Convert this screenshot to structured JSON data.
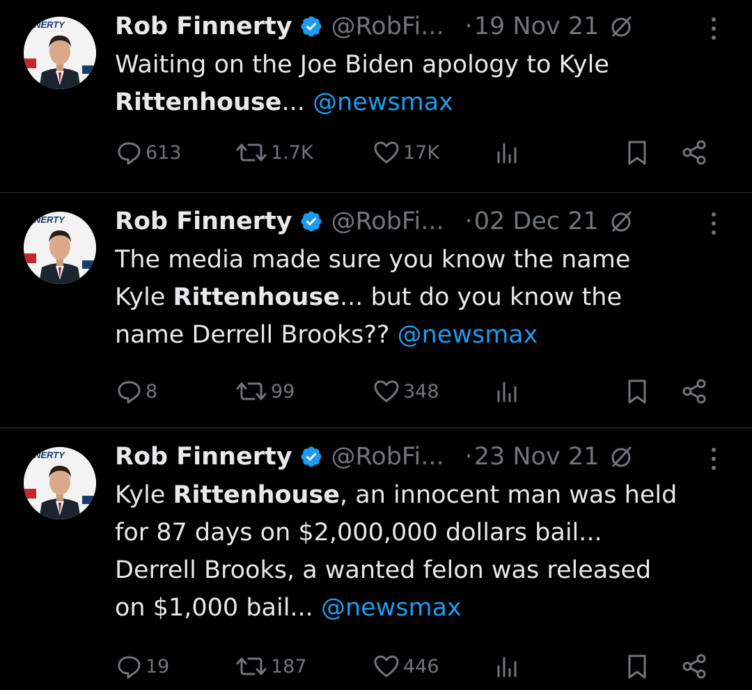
{
  "tweets": [
    {
      "name": "Rob Finnerty",
      "handle": "@RobFi...",
      "dot": "·",
      "date": "19 Nov 21",
      "avatar_text": "FINNERTY",
      "lines": [
        [
          {
            "t": "Waiting on the Joe Biden apology to Kyle"
          }
        ],
        [
          {
            "t": "Rittenhouse",
            "b": true
          },
          {
            "t": "... "
          },
          {
            "t": "@newsmax",
            "m": true
          }
        ]
      ],
      "replies": "613",
      "reposts": "1.7K",
      "likes": "17K"
    },
    {
      "name": "Rob Finnerty",
      "handle": "@RobFi...",
      "dot": "·",
      "date": "02 Dec 21",
      "avatar_text": "FINNERTY",
      "lines": [
        [
          {
            "t": "The media made sure you know the name"
          }
        ],
        [
          {
            "t": "Kyle "
          },
          {
            "t": "Rittenhouse",
            "b": true
          },
          {
            "t": "... but do you know the"
          }
        ],
        [
          {
            "t": "name Derrell Brooks??  "
          },
          {
            "t": "@newsmax",
            "m": true
          }
        ]
      ],
      "replies": "8",
      "reposts": "99",
      "likes": "348"
    },
    {
      "name": "Rob Finnerty",
      "handle": "@RobFi...",
      "dot": "·",
      "date": "23 Nov 21",
      "avatar_text": "FINNERTY",
      "lines": [
        [
          {
            "t": "Kyle "
          },
          {
            "t": "Rittenhouse",
            "b": true
          },
          {
            "t": ", an innocent man was held"
          }
        ],
        [
          {
            "t": "for 87 days on $2,000,000 dollars bail..."
          }
        ],
        [
          {
            "t": "Derrell Brooks, a wanted felon was released"
          }
        ],
        [
          {
            "t": "on $1,000 bail... "
          },
          {
            "t": "@newsmax",
            "m": true
          }
        ]
      ],
      "replies": "19",
      "reposts": "187",
      "likes": "446"
    }
  ],
  "colors": {
    "background": "#000000",
    "text": "#e7e9ea",
    "muted": "#71767b",
    "mention": "#1d9bf0",
    "verified": "#1d9bf0",
    "divider": "#2f3336"
  },
  "icons": [
    "verified-badge-icon",
    "no-reply-icon",
    "more-icon",
    "reply-icon",
    "repost-icon",
    "like-icon",
    "views-icon",
    "bookmark-icon",
    "share-icon"
  ]
}
